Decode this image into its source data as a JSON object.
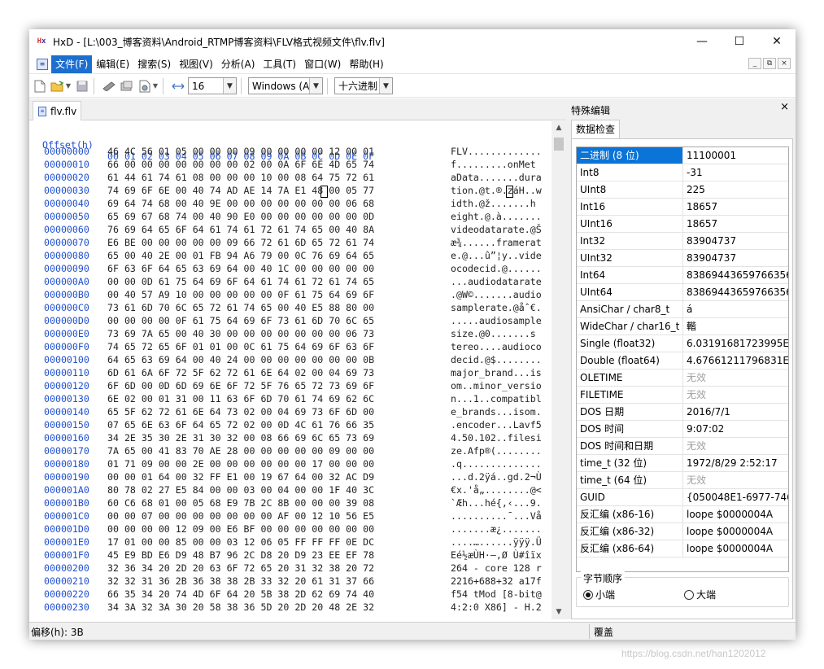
{
  "window": {
    "title": "HxD - [L:\\003_博客资料\\Android_RTMP博客资料\\FLV格式视频文件\\flv.flv]",
    "minimize": "—",
    "maximize": "☐",
    "close": "✕"
  },
  "menu": [
    "文件(F)",
    "编辑(E)",
    "搜索(S)",
    "视图(V)",
    "分析(A)",
    "工具(T)",
    "窗口(W)",
    "帮助(H)"
  ],
  "mdi": {
    "min": "_",
    "restore": "⧉",
    "close": "×"
  },
  "toolbar": {
    "bytes_per_row": "16",
    "charset": "Windows (AN",
    "offset_base": "十六进制"
  },
  "tab": {
    "label": "flv.flv"
  },
  "hex": {
    "header_offset": "Offset(h)",
    "header_bytes": "00 01 02 03 04 05 06 07 08 09 0A 0B 0C 0D 0E 0F",
    "rows": [
      {
        "off": "00000000",
        "bytes": "46 4C 56 01 05 00 00 00 09 00 00 00 00 12 00 01",
        "ascii": "FLV............."
      },
      {
        "off": "00000010",
        "bytes": "66 00 00 00 00 00 00 00 02 00 0A 6F 6E 4D 65 74",
        "ascii": "f.........onMet"
      },
      {
        "off": "00000020",
        "bytes": "61 44 61 74 61 08 00 00 00 10 00 08 64 75 72 61",
        "ascii": "aData.......dura"
      },
      {
        "off": "00000030",
        "bytes": "74 69 6F 6E 00 40 74 AD AE 14 7A E1 48 00 05 77",
        "ascii": "tion.@t.®.záH..w"
      },
      {
        "off": "00000040",
        "bytes": "69 64 74 68 00 40 9E 00 00 00 00 00 00 00 06 68",
        "ascii": "idth.@ž.......h"
      },
      {
        "off": "00000050",
        "bytes": "65 69 67 68 74 00 40 90 E0 00 00 00 00 00 00 0D",
        "ascii": "eight.@.à......."
      },
      {
        "off": "00000060",
        "bytes": "76 69 64 65 6F 64 61 74 61 72 61 74 65 00 40 8A",
        "ascii": "videodatarate.@Š"
      },
      {
        "off": "00000070",
        "bytes": "E6 BE 00 00 00 00 00 09 66 72 61 6D 65 72 61 74",
        "ascii": "æ¾......framerat"
      },
      {
        "off": "00000080",
        "bytes": "65 00 40 2E 00 01 FB 94 A6 79 00 0C 76 69 64 65",
        "ascii": "e.@...û”¦y..vide"
      },
      {
        "off": "00000090",
        "bytes": "6F 63 6F 64 65 63 69 64 00 40 1C 00 00 00 00 00",
        "ascii": "ocodecid.@......"
      },
      {
        "off": "000000A0",
        "bytes": "00 00 0D 61 75 64 69 6F 64 61 74 61 72 61 74 65",
        "ascii": "...audiodatarate"
      },
      {
        "off": "000000B0",
        "bytes": "00 40 57 A9 10 00 00 00 00 00 0F 61 75 64 69 6F",
        "ascii": ".@W©.......audio"
      },
      {
        "off": "000000C0",
        "bytes": "73 61 6D 70 6C 65 72 61 74 65 00 40 E5 88 80 00",
        "ascii": "samplerate.@åˆ€."
      },
      {
        "off": "000000D0",
        "bytes": "00 00 00 00 0F 61 75 64 69 6F 73 61 6D 70 6C 65",
        "ascii": ".....audiosample"
      },
      {
        "off": "000000E0",
        "bytes": "73 69 7A 65 00 40 30 00 00 00 00 00 00 00 06 73",
        "ascii": "size.@0.......s"
      },
      {
        "off": "000000F0",
        "bytes": "74 65 72 65 6F 01 01 00 0C 61 75 64 69 6F 63 6F",
        "ascii": "tereo....audioco"
      },
      {
        "off": "00000100",
        "bytes": "64 65 63 69 64 00 40 24 00 00 00 00 00 00 00 0B",
        "ascii": "decid.@$........"
      },
      {
        "off": "00000110",
        "bytes": "6D 61 6A 6F 72 5F 62 72 61 6E 64 02 00 04 69 73",
        "ascii": "major_brand...is"
      },
      {
        "off": "00000120",
        "bytes": "6F 6D 00 0D 6D 69 6E 6F 72 5F 76 65 72 73 69 6F",
        "ascii": "om..minor_versio"
      },
      {
        "off": "00000130",
        "bytes": "6E 02 00 01 31 00 11 63 6F 6D 70 61 74 69 62 6C",
        "ascii": "n...1..compatibl"
      },
      {
        "off": "00000140",
        "bytes": "65 5F 62 72 61 6E 64 73 02 00 04 69 73 6F 6D 00",
        "ascii": "e_brands...isom."
      },
      {
        "off": "00000150",
        "bytes": "07 65 6E 63 6F 64 65 72 02 00 0D 4C 61 76 66 35",
        "ascii": ".encoder...Lavf5"
      },
      {
        "off": "00000160",
        "bytes": "34 2E 35 30 2E 31 30 32 00 08 66 69 6C 65 73 69",
        "ascii": "4.50.102..filesi"
      },
      {
        "off": "00000170",
        "bytes": "7A 65 00 41 83 70 AE 28 00 00 00 00 00 09 00 00",
        "ascii": "ze.Afp®(........"
      },
      {
        "off": "00000180",
        "bytes": "01 71 09 00 00 2E 00 00 00 00 00 00 17 00 00 00",
        "ascii": ".q.............."
      },
      {
        "off": "00000190",
        "bytes": "00 00 01 64 00 32 FF E1 00 19 67 64 00 32 AC D9",
        "ascii": "...d.2ÿá..gd.2¬Ù"
      },
      {
        "off": "000001A0",
        "bytes": "80 78 02 27 E5 84 00 00 03 00 04 00 00 1F 40 3C",
        "ascii": "€x.'å„........@<"
      },
      {
        "off": "000001B0",
        "bytes": "60 C6 68 01 00 05 68 E9 7B 2C 8B 00 00 00 39 08",
        "ascii": "`Æh...hé{,‹...9."
      },
      {
        "off": "000001C0",
        "bytes": "00 00 07 00 00 00 00 00 00 00 AF 00 12 10 56 E5",
        "ascii": "..........¯...Vå"
      },
      {
        "off": "000001D0",
        "bytes": "00 00 00 00 12 09 00 E6 BF 00 00 00 00 00 00 00",
        "ascii": ".......æ¿......."
      },
      {
        "off": "000001E0",
        "bytes": "17 01 00 00 85 00 00 03 12 06 05 FF FF FF 0E DC",
        "ascii": "....…......ÿÿÿ.Ü"
      },
      {
        "off": "000001F0",
        "bytes": "45 E9 BD E6 D9 48 B7 96 2C D8 20 D9 23 EE EF 78",
        "ascii": "Eé½æÙH·–,Ø Ù#îïx"
      },
      {
        "off": "00000200",
        "bytes": "32 36 34 20 2D 20 63 6F 72 65 20 31 32 38 20 72",
        "ascii": "264 - core 128 r"
      },
      {
        "off": "00000210",
        "bytes": "32 32 31 36 2B 36 38 38 2B 33 32 20 61 31 37 66",
        "ascii": "2216+688+32 a17f"
      },
      {
        "off": "00000220",
        "bytes": "66 35 34 20 74 4D 6F 64 20 5B 38 2D 62 69 74 40",
        "ascii": "f54 tMod [8-bit@"
      },
      {
        "off": "00000230",
        "bytes": "34 3A 32 3A 30 20 58 38 36 5D 20 2D 20 48 2E 32",
        "ascii": "4:2:0 X86] - H.2"
      }
    ]
  },
  "panel": {
    "title": "特殊编辑",
    "close": "×",
    "tab": "数据检查",
    "rows": [
      {
        "k": "二进制 (8 位)",
        "v": "11100001"
      },
      {
        "k": "Int8",
        "v": "-31"
      },
      {
        "k": "UInt8",
        "v": "225"
      },
      {
        "k": "Int16",
        "v": "18657"
      },
      {
        "k": "UInt16",
        "v": "18657"
      },
      {
        "k": "Int32",
        "v": "83904737"
      },
      {
        "k": "UInt32",
        "v": "83904737"
      },
      {
        "k": "Int64",
        "v": "838694436597663561"
      },
      {
        "k": "UInt64",
        "v": "838694436597663561"
      },
      {
        "k": "AnsiChar / char8_t",
        "v": "á"
      },
      {
        "k": "WideChar / char16_t",
        "v": "䡡"
      },
      {
        "k": "Single (float32)",
        "v": "6.03191681723995E-3"
      },
      {
        "k": "Double (float64)",
        "v": "4.67661211796831E25"
      },
      {
        "k": "OLETIME",
        "v": "无效"
      },
      {
        "k": "FILETIME",
        "v": "无效"
      },
      {
        "k": "DOS 日期",
        "v": "2016/7/1"
      },
      {
        "k": "DOS 时间",
        "v": "9:07:02"
      },
      {
        "k": "DOS 时间和日期",
        "v": "无效"
      },
      {
        "k": "time_t (32 位)",
        "v": "1972/8/29 2:52:17"
      },
      {
        "k": "time_t (64 位)",
        "v": "无效"
      },
      {
        "k": "GUID",
        "v": "{050048E1-6977-7464"
      },
      {
        "k": "反汇编 (x86-16)",
        "v": "loope $0000004A"
      },
      {
        "k": "反汇编 (x86-32)",
        "v": "loope $0000004A"
      },
      {
        "k": "反汇编 (x86-64)",
        "v": "loope $0000004A"
      }
    ],
    "byte_order_label": "字节顺序",
    "little_endian": "小端",
    "big_endian": "大端"
  },
  "status": {
    "offset": "偏移(h): 3B",
    "mode": "覆盖"
  },
  "watermark": "https://blog.csdn.net/han1202012"
}
